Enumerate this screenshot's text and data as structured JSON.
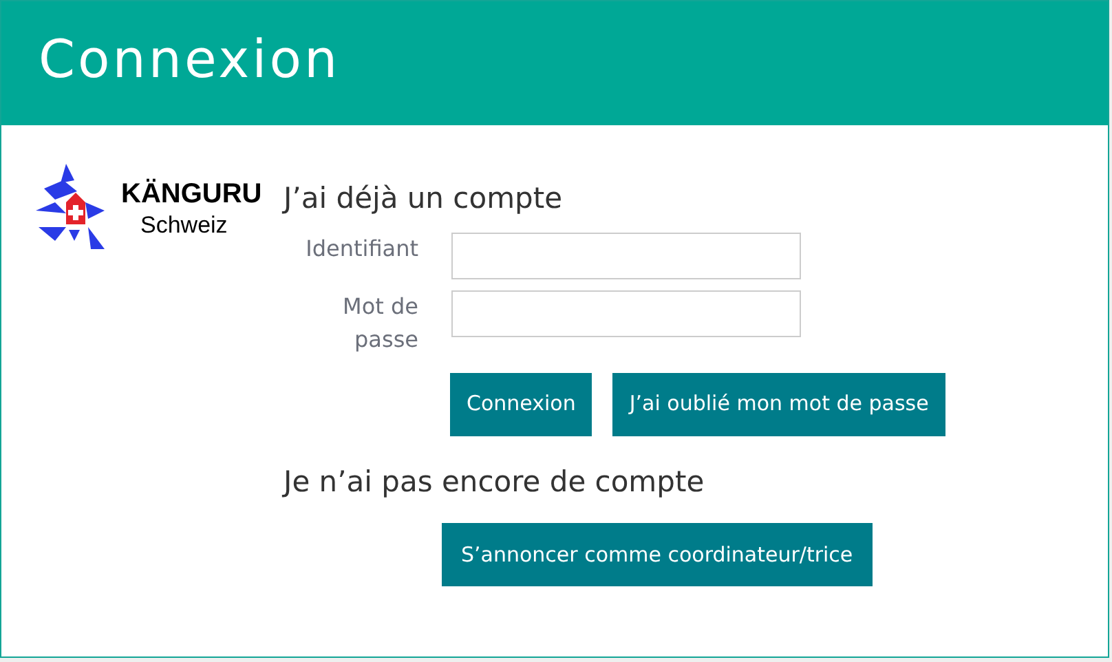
{
  "dialog": {
    "title": "Connexion"
  },
  "logo": {
    "name": "KÄNGURU",
    "subtitle": "Schweiz"
  },
  "login": {
    "heading": "J’ai déjà un compte",
    "fields": [
      {
        "label": "Identifiant"
      },
      {
        "label": "Mot de passe"
      }
    ],
    "buttons": [
      "Connexion",
      "J’ai oublié mon mot de passe"
    ]
  },
  "register": {
    "heading": "Je n’ai pas encore de compte",
    "button": "S’annoncer comme coordinateur/trice"
  }
}
